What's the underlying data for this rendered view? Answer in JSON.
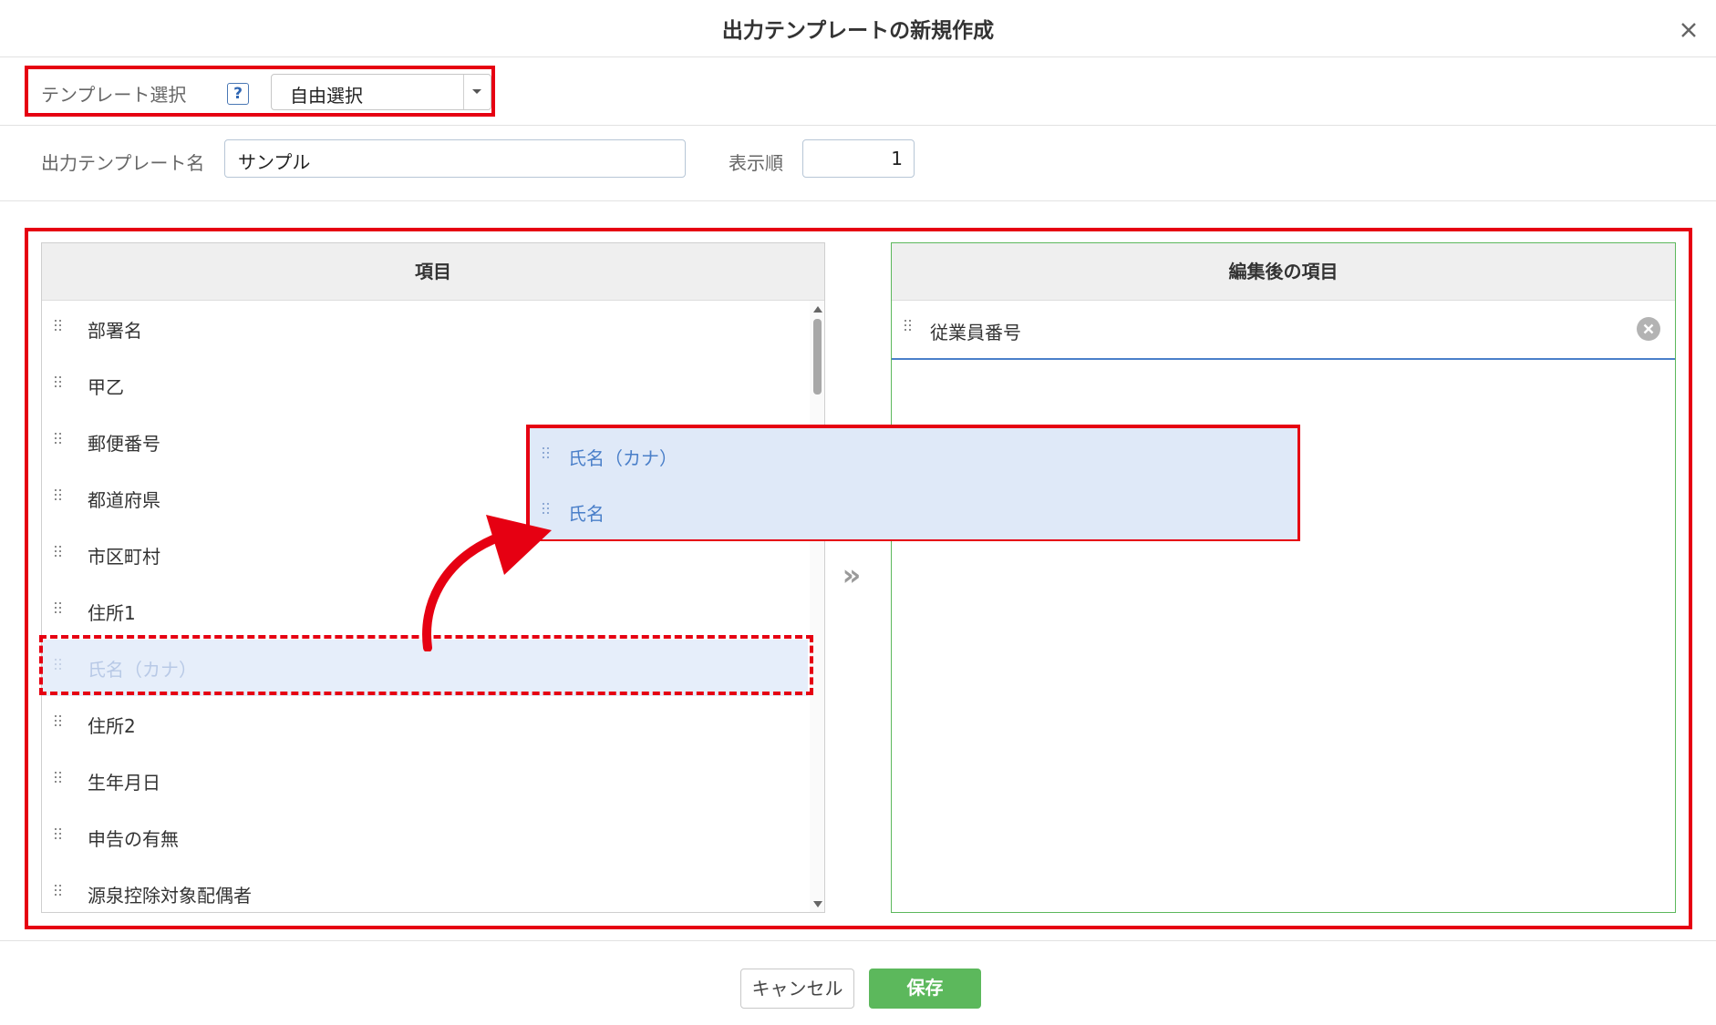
{
  "dialog": {
    "title": "出力テンプレートの新規作成"
  },
  "template_select": {
    "label": "テンプレート選択",
    "help": "?",
    "value": "自由選択"
  },
  "template_name": {
    "label": "出力テンプレート名",
    "value": "サンプル"
  },
  "display_order": {
    "label": "表示順",
    "value": "1"
  },
  "left_panel": {
    "header": "項目",
    "items": [
      "部署名",
      "甲乙",
      "郵便番号",
      "都道府県",
      "市区町村",
      "住所1",
      "氏名（カナ）",
      "住所2",
      "生年月日",
      "申告の有無",
      "源泉控除対象配偶者"
    ]
  },
  "move_button": "»",
  "right_panel": {
    "header": "編集後の項目",
    "items": [
      "従業員番号"
    ]
  },
  "dragging_items": [
    "氏名（カナ）",
    "氏名"
  ],
  "footer": {
    "cancel": "キャンセル",
    "save": "保存"
  },
  "colors": {
    "highlight": "#e60012",
    "save": "#5cb85c",
    "drag": "#dfe9f8",
    "accent_line": "#4a7fc9"
  }
}
